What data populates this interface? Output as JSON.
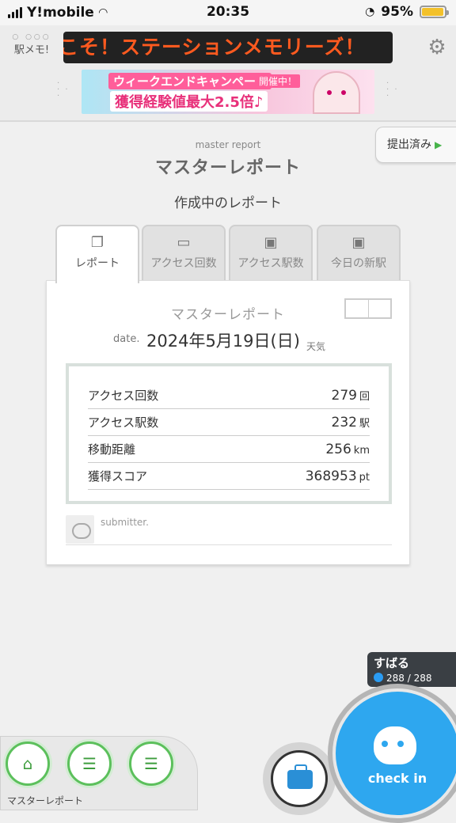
{
  "status_bar": {
    "carrier": "Y!mobile",
    "time": "20:35",
    "battery": "95%",
    "battery_level": 0.95
  },
  "header": {
    "logo_text": "駅メモ!",
    "ticker_text": "こそ！ステーションメモリーズ！",
    "banner": {
      "line1": "ウィークエンドキャンペーン",
      "badge": "開催中！",
      "line2": "獲得経験値最大2.5倍♪"
    }
  },
  "submitted_tab": {
    "label": "提出済み"
  },
  "page": {
    "subtitle_en": "master report",
    "title": "マスターレポート",
    "section": "作成中のレポート"
  },
  "tabs": [
    {
      "label": "レポート",
      "icon": "report-icon",
      "active": true
    },
    {
      "label": "アクセス回数",
      "icon": "access-count-icon",
      "active": false
    },
    {
      "label": "アクセス駅数",
      "icon": "station-count-icon",
      "active": false
    },
    {
      "label": "今日の新駅",
      "icon": "new-station-icon",
      "active": false
    }
  ],
  "report": {
    "heading": "マスターレポート",
    "date_label": "date.",
    "date_value": "2024年5月19日(日)",
    "weather_label": "天気",
    "stats": [
      {
        "label": "アクセス回数",
        "value": "279",
        "unit": "回"
      },
      {
        "label": "アクセス駅数",
        "value": "232",
        "unit": "駅"
      },
      {
        "label": "移動距離",
        "value": "256",
        "unit": "km"
      },
      {
        "label": "獲得スコア",
        "value": "368953",
        "unit": "pt"
      }
    ],
    "submitter_label": "submitter."
  },
  "user": {
    "name": "すばる",
    "count": "288 / 288"
  },
  "checkin": {
    "label": "check in"
  },
  "bottom_nav": {
    "label": "マスターレポート"
  }
}
